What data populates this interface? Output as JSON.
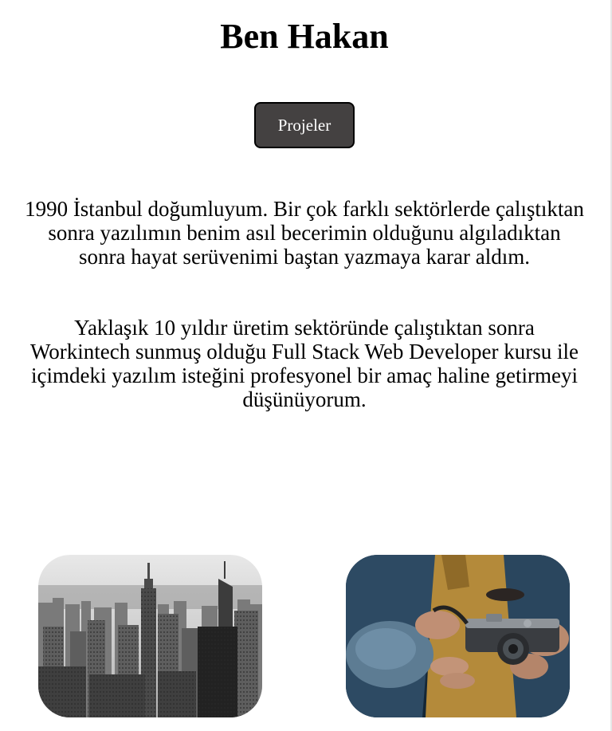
{
  "header": {
    "title": "Ben Hakan"
  },
  "nav": {
    "projects_label": "Projeler"
  },
  "bio": {
    "paragraph_1": "1990 İstanbul doğumluyum. Bir çok farklı sektörlerde çalıştıktan sonra yazılımın benim asıl becerimin olduğunu algıladıktan sonra hayat serüvenimi baştan yazmaya karar aldım.",
    "paragraph_2": "Yaklaşık 10 yıldır üretim sektöründe çalıştıktan sonra Workintech sunmuş olduğu Full Stack Web Developer kursu ile içimdeki yazılım isteğini profesyonel bir amaç haline getirmeyi düşünüyorum."
  },
  "colors": {
    "button_bg": "#444141",
    "button_text": "#ffffff",
    "text": "#000000"
  }
}
